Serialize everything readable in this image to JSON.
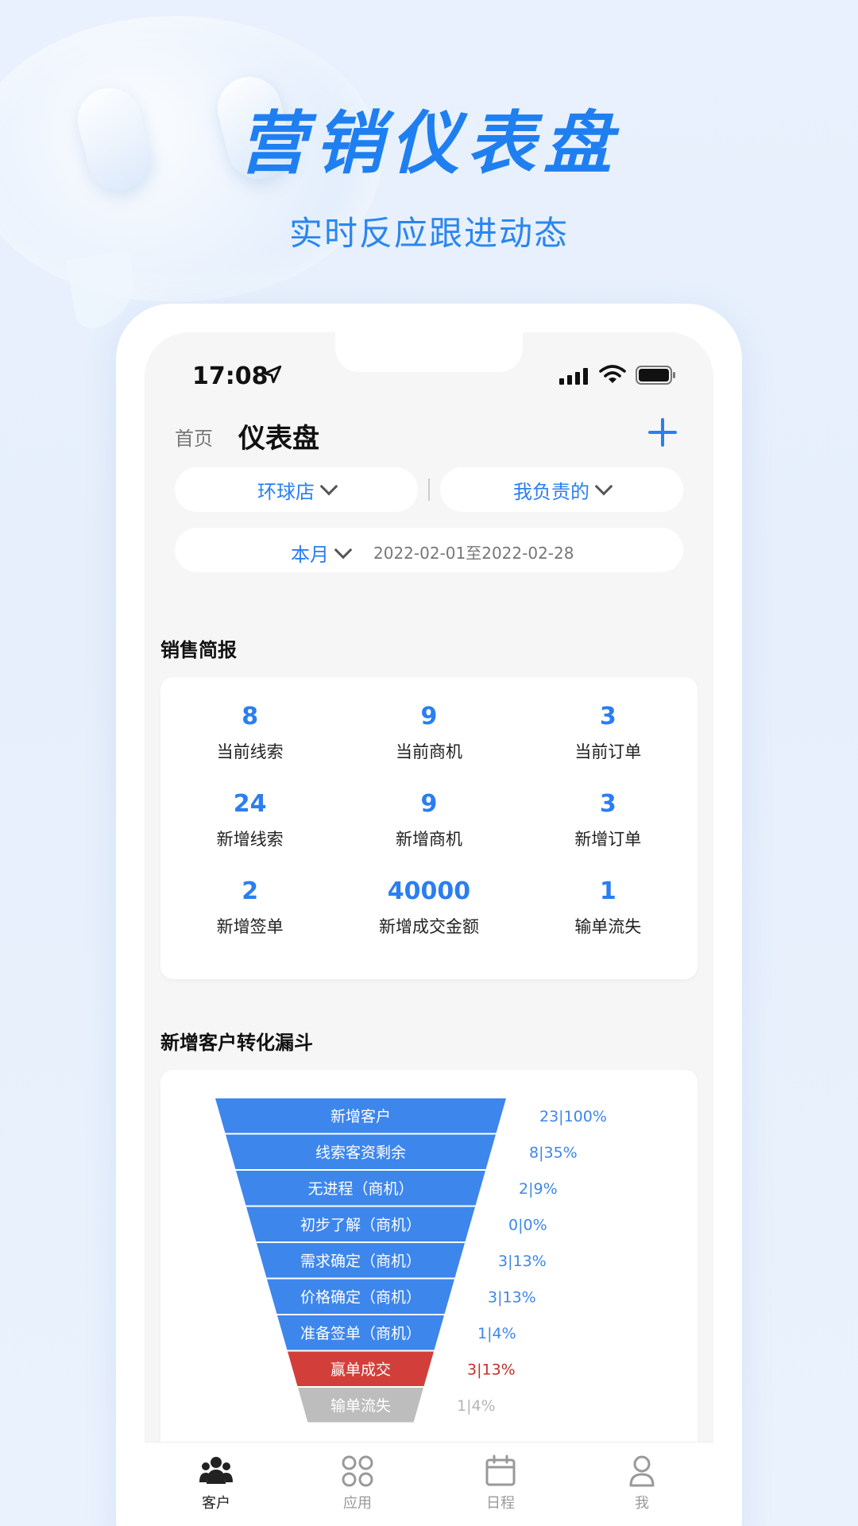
{
  "promo": {
    "headline": "营销仪表盘",
    "subline": "实时反应跟进动态"
  },
  "status_bar": {
    "time": "17:08"
  },
  "nav": {
    "home": "首页",
    "title": "仪表盘"
  },
  "filters": {
    "store": "环球店",
    "scope": "我负责的",
    "period": "本月",
    "date_range": "2022-02-01至2022-02-28"
  },
  "sales_report": {
    "title": "销售简报",
    "stats": [
      {
        "value": "8",
        "label": "当前线索"
      },
      {
        "value": "9",
        "label": "当前商机"
      },
      {
        "value": "3",
        "label": "当前订单"
      },
      {
        "value": "24",
        "label": "新增线索"
      },
      {
        "value": "9",
        "label": "新增商机"
      },
      {
        "value": "3",
        "label": "新增订单"
      },
      {
        "value": "2",
        "label": "新增签单"
      },
      {
        "value": "40000",
        "label": "新增成交金额"
      },
      {
        "value": "1",
        "label": "输单流失"
      }
    ]
  },
  "funnel_section": {
    "title": "新增客户转化漏斗"
  },
  "chart_data": {
    "type": "funnel",
    "stages": [
      {
        "name": "新增客户",
        "count": 23,
        "percent": 100,
        "label": "23|100%",
        "color": "#3d86ec"
      },
      {
        "name": "线索客资剩余",
        "count": 8,
        "percent": 35,
        "label": "8|35%",
        "color": "#3d86ec"
      },
      {
        "name": "无进程（商机）",
        "count": 2,
        "percent": 9,
        "label": "2|9%",
        "color": "#3d86ec"
      },
      {
        "name": "初步了解（商机）",
        "count": 0,
        "percent": 0,
        "label": "0|0%",
        "color": "#3d86ec"
      },
      {
        "name": "需求确定（商机）",
        "count": 3,
        "percent": 13,
        "label": "3|13%",
        "color": "#3d86ec"
      },
      {
        "name": "价格确定（商机）",
        "count": 3,
        "percent": 13,
        "label": "3|13%",
        "color": "#3d86ec"
      },
      {
        "name": "准备签单（商机）",
        "count": 1,
        "percent": 4,
        "label": "1|4%",
        "color": "#3d86ec"
      },
      {
        "name": "赢单成交",
        "count": 3,
        "percent": 13,
        "label": "3|13%",
        "color": "#d23f3a"
      },
      {
        "name": "输单流失",
        "count": 1,
        "percent": 4,
        "label": "1|4%",
        "color": "#bdbdbd"
      }
    ],
    "label_colors": {
      "default": "#3d86ec",
      "won": "#c0302a",
      "lost": "#b5b5b5"
    }
  },
  "tabbar": {
    "items": [
      {
        "label": "客户",
        "icon": "users-icon",
        "active": true
      },
      {
        "label": "应用",
        "icon": "apps-icon",
        "active": false
      },
      {
        "label": "日程",
        "icon": "calendar-icon",
        "active": false
      },
      {
        "label": "我",
        "icon": "profile-icon",
        "active": false
      }
    ]
  }
}
